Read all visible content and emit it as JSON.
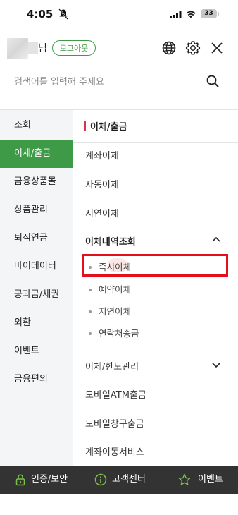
{
  "status_bar": {
    "time": "4:05",
    "battery": "33"
  },
  "header": {
    "user_suffix": "님",
    "logout_label": "로그아웃",
    "icons": [
      "globe-icon",
      "gear-icon",
      "close-icon"
    ]
  },
  "search": {
    "placeholder": "검색어를 입력해 주세요",
    "value": ""
  },
  "left_nav": {
    "items": [
      {
        "label": "조회"
      },
      {
        "label": "이체/출금"
      },
      {
        "label": "금융상품몰"
      },
      {
        "label": "상품관리"
      },
      {
        "label": "퇴직연금"
      },
      {
        "label": "마이데이터"
      },
      {
        "label": "공과금/채권"
      },
      {
        "label": "외환"
      },
      {
        "label": "이벤트"
      },
      {
        "label": "금융편의"
      }
    ],
    "active_index": 1
  },
  "content": {
    "section_title": "이체/출금",
    "items_top": [
      "계좌이체",
      "자동이체",
      "지연이체"
    ],
    "group_expanded": {
      "title": "이체내역조회",
      "sub_items": [
        "즉시이체",
        "예약이체",
        "지연이체",
        "연락처송금"
      ]
    },
    "group_collapsed": {
      "title": "이체/한도관리"
    },
    "items_bottom": [
      "모바일ATM출금",
      "모바일창구출금",
      "계좌이동서비스"
    ]
  },
  "footer": {
    "items": [
      {
        "label": "인증/보안",
        "icon": "lock-icon"
      },
      {
        "label": "고객센터",
        "icon": "info-icon"
      },
      {
        "label": "이벤트",
        "icon": "star-icon"
      }
    ]
  },
  "colors": {
    "accent_green": "#3f9a48",
    "highlight_red": "#e3101c",
    "section_bar": "#d9334f",
    "footer_bg": "#333333"
  }
}
